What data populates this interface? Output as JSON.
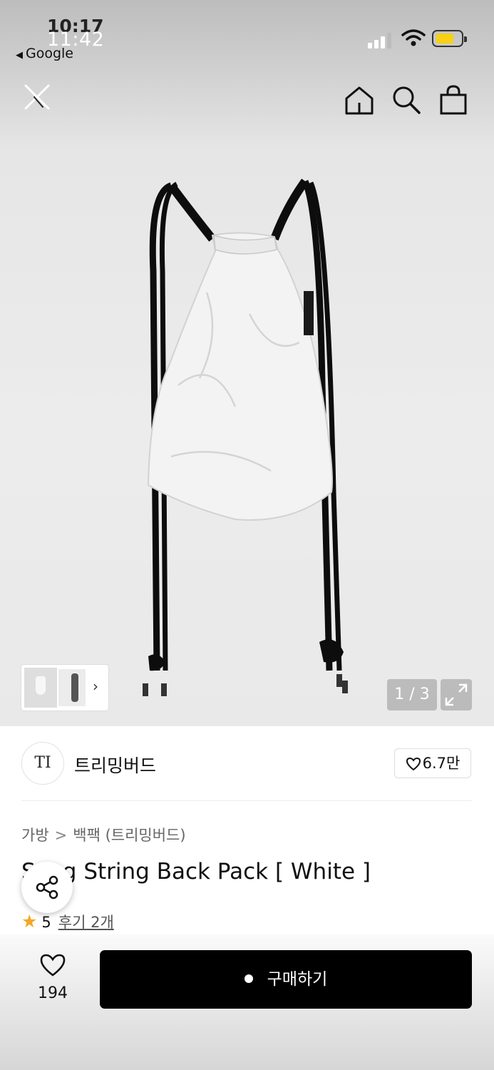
{
  "status_bar": {
    "time_back": "10:17",
    "time_front": "11:42",
    "back_app_label": "Google",
    "battery_color": "#f6d114"
  },
  "nav": {
    "icons": [
      "close-icon",
      "home-icon",
      "search-icon",
      "shopping-bag-icon"
    ]
  },
  "gallery": {
    "counter": "1 / 3",
    "thumb_arrow": "›"
  },
  "brand": {
    "logo_text": "TI",
    "name": "트리밍버드",
    "likes": "6.7만"
  },
  "breadcrumb": {
    "category": "가방",
    "separator": ">",
    "subcategory": "백팩 (트리밍버드)"
  },
  "product": {
    "title": "S   ing String Back Pack [ White ]",
    "rating": "5",
    "reviews_link": "후기 2개"
  },
  "bottom": {
    "wishlist_count": "194",
    "buy_label": "구매하기"
  }
}
